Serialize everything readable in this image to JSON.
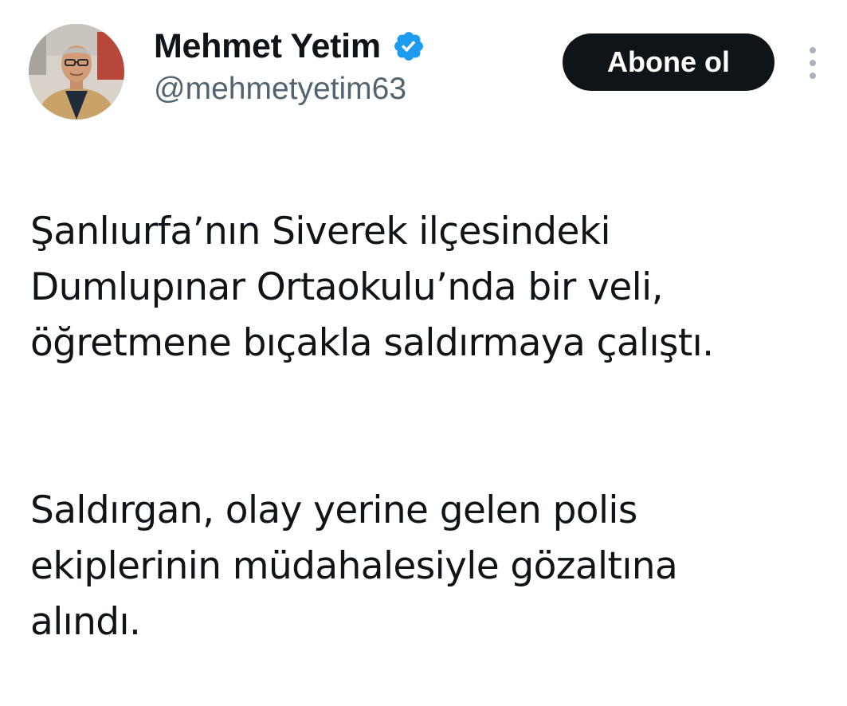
{
  "author": {
    "display_name": "Mehmet Yetim",
    "handle": "@mehmetyetim63",
    "verified": true,
    "avatar_icon": "profile-photo",
    "verified_icon": "verified-badge-icon"
  },
  "actions": {
    "follow_label": "Abone ol",
    "more_icon": "more-vertical-icon"
  },
  "tweet": {
    "paragraphs": [
      "Şanlıurfa’nın Siverek ilçesindeki\nDumlupınar Ortaokulu’nda bir veli,\nöğretmene bıçakla saldırmaya çalıştı.",
      "Saldırgan, olay yerine gelen polis\nekiplerinin müdahalesiyle gözaltına\nalındı."
    ]
  },
  "colors": {
    "verified": "#1d9bf0",
    "button_bg": "#0f1419",
    "handle_text": "#536471"
  }
}
